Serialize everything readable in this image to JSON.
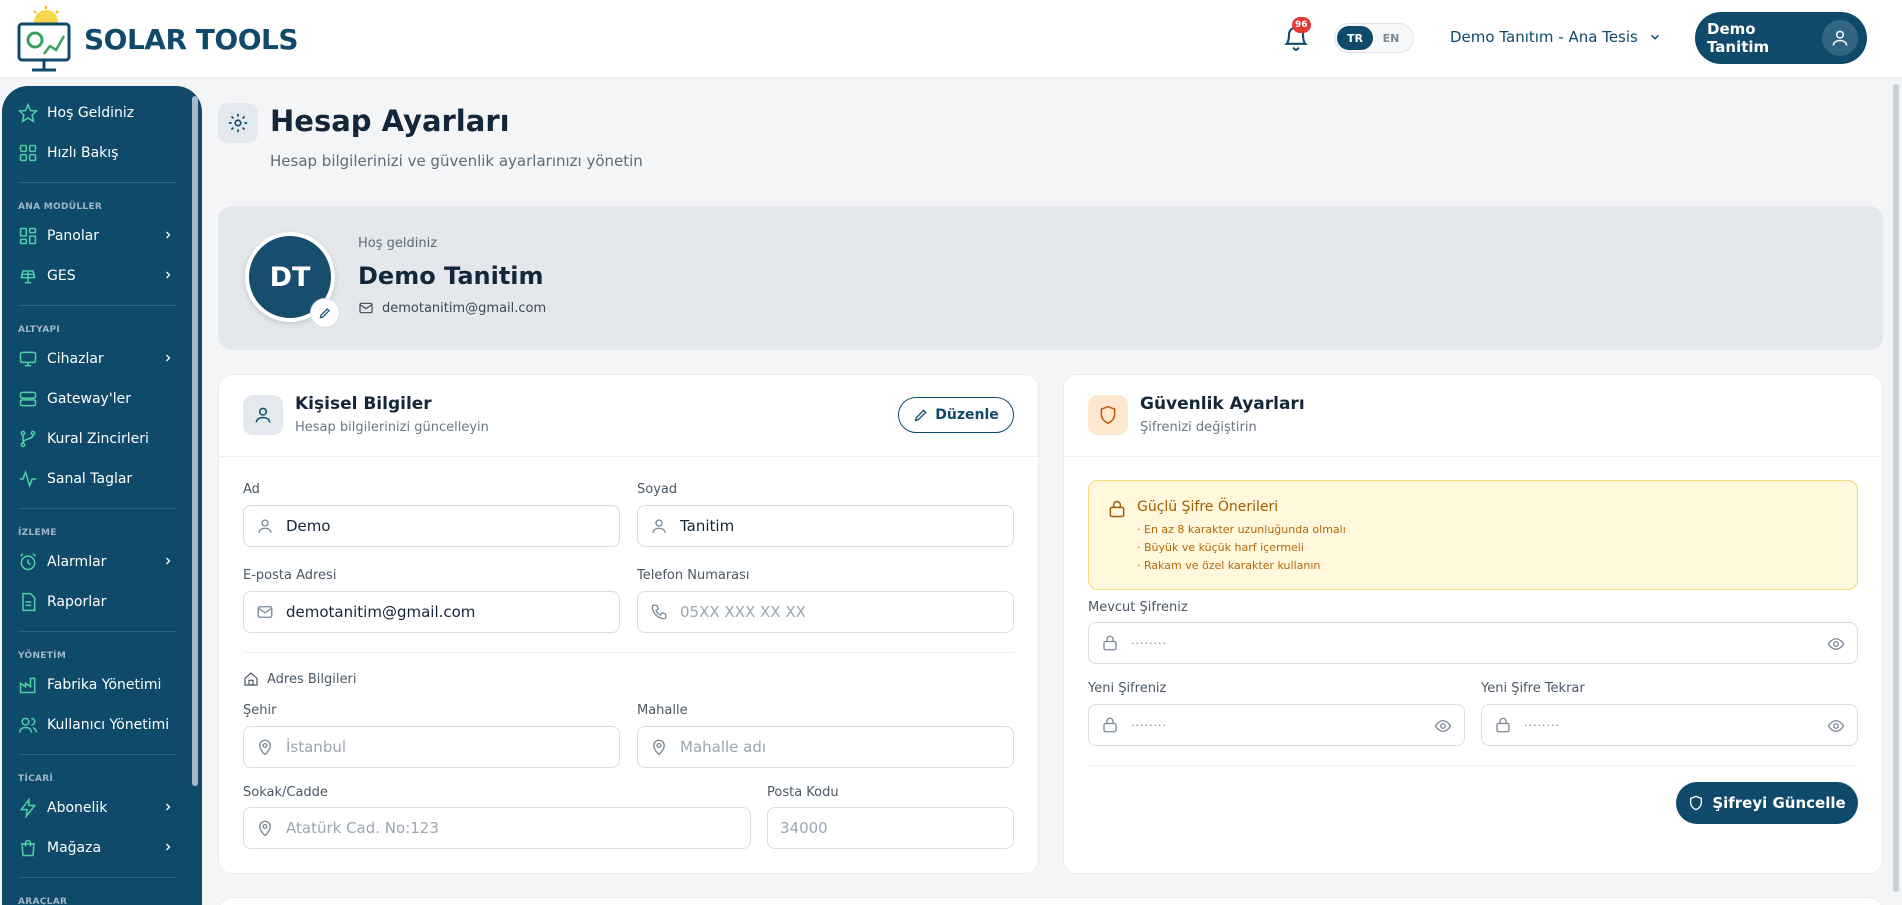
{
  "app": {
    "brand": "SOLAR TOOLS"
  },
  "header": {
    "notification_count": "96",
    "lang_options": [
      "TR",
      "EN"
    ],
    "lang_active": "TR",
    "facility": "Demo Tanıtım - Ana Tesis",
    "user_name": "Demo Tanitim"
  },
  "sidebar": {
    "welcome": "Hoş Geldiniz",
    "quick_view": "Hızlı Bakış",
    "sections": {
      "main": "ANA MODÜLLER",
      "infra": "ALTYAPI",
      "monitor": "İZLEME",
      "admin": "YÖNETİM",
      "commercial": "TİCARİ",
      "tools": "ARAÇLAR"
    },
    "items": {
      "panels": "Panolar",
      "ges": "GES",
      "devices": "Cihazlar",
      "gateways": "Gateway'ler",
      "rule_chains": "Kural Zincirleri",
      "virtual_tags": "Sanal Taglar",
      "alarms": "Alarmlar",
      "reports": "Raporlar",
      "factory": "Fabrika Yönetimi",
      "users": "Kullanıcı Yönetimi",
      "subscription": "Abonelik",
      "store": "Mağaza"
    }
  },
  "page": {
    "title": "Hesap Ayarları",
    "subtitle": "Hesap bilgilerinizi ve güvenlik ayarlarınızı yönetin"
  },
  "profile": {
    "initials": "DT",
    "welcome": "Hoş geldiniz",
    "name": "Demo Tanitim",
    "email": "demotanitim@gmail.com"
  },
  "personal": {
    "title": "Kişisel Bilgiler",
    "subtitle": "Hesap bilgilerinizi güncelleyin",
    "edit_label": "Düzenle",
    "first_name_label": "Ad",
    "first_name": "Demo",
    "last_name_label": "Soyad",
    "last_name": "Tanitim",
    "email_label": "E-posta Adresi",
    "email": "demotanitim@gmail.com",
    "phone_label": "Telefon Numarası",
    "phone_placeholder": "05XX XXX XX XX",
    "address_heading": "Adres Bilgileri",
    "city_label": "Şehir",
    "city_placeholder": "İstanbul",
    "district_label": "Mahalle",
    "district_placeholder": "Mahalle adı",
    "street_label": "Sokak/Cadde",
    "street_placeholder": "Atatürk Cad. No:123",
    "zip_label": "Posta Kodu",
    "zip_placeholder": "34000"
  },
  "security": {
    "title": "Güvenlik Ayarları",
    "subtitle": "Şifrenizi değiştirin",
    "tips_title": "Güçlü Şifre Önerileri",
    "tips": [
      "· En az 8 karakter uzunluğunda olmalı",
      "· Büyük ve küçük harf içermeli",
      "· Rakam ve özel karakter kullanın"
    ],
    "current_label": "Mevcut Şifreniz",
    "new_label": "Yeni Şifreniz",
    "confirm_label": "Yeni Şifre Tekrar",
    "masked": "········",
    "update_label": "Şifreyi Güncelle"
  },
  "colors": {
    "primary": "#0f4a6b",
    "badge": "#e53935",
    "tips_bg": "#fff8dc",
    "tips_text": "#b5670a"
  }
}
